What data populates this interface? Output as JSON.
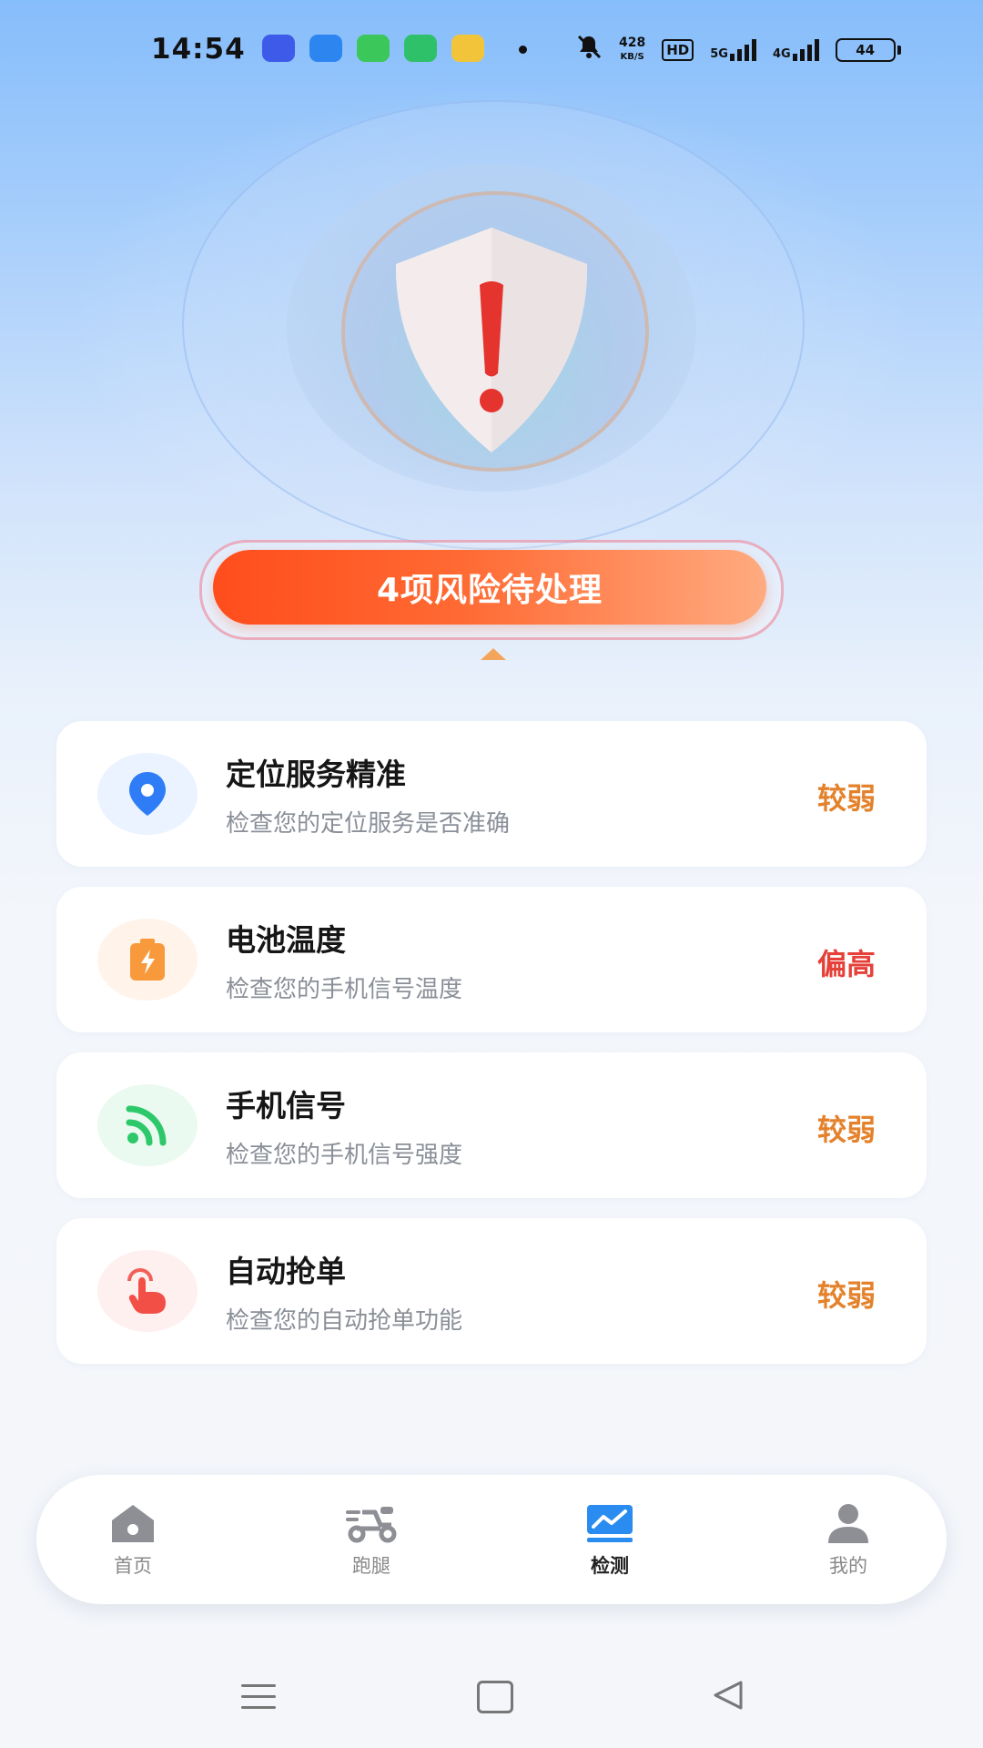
{
  "status_bar": {
    "time": "14:54",
    "notification_icons": [
      "app-icon-blue",
      "app-icon-blue-light",
      "app-icon-green",
      "app-icon-green-chat",
      "app-icon-yellow"
    ],
    "net_speed_value": "428",
    "net_speed_unit": "KB/S",
    "hd_label": "HD",
    "signal_5g_label": "5G",
    "signal2_label": "4G",
    "battery": "44"
  },
  "risk": {
    "label": "4项风险待处理"
  },
  "items": [
    {
      "title": "定位服务精准",
      "desc": "检查您的定位服务是否准确",
      "status": "较弱",
      "icon": "location-pin-icon",
      "status_color": "#e4822c"
    },
    {
      "title": "电池温度",
      "desc": "检查您的手机信号温度",
      "status": "偏高",
      "icon": "battery-charging-icon",
      "status_color": "#e5413a"
    },
    {
      "title": "手机信号",
      "desc": "检查您的手机信号强度",
      "status": "较弱",
      "icon": "signal-wifi-icon",
      "status_color": "#e4822c"
    },
    {
      "title": "自动抢单",
      "desc": "检查您的自动抢单功能",
      "status": "较弱",
      "icon": "tap-hand-icon",
      "status_color": "#e4822c"
    }
  ],
  "bottom_nav": [
    {
      "label": "首页",
      "icon": "home-icon",
      "active": false
    },
    {
      "label": "跑腿",
      "icon": "scooter-icon",
      "active": false
    },
    {
      "label": "检测",
      "icon": "chart-monitor-icon",
      "active": true
    },
    {
      "label": "我的",
      "icon": "user-icon",
      "active": false
    }
  ],
  "colors": {
    "accent_orange": "#ff5a22",
    "active_blue": "#2a8cf0"
  }
}
